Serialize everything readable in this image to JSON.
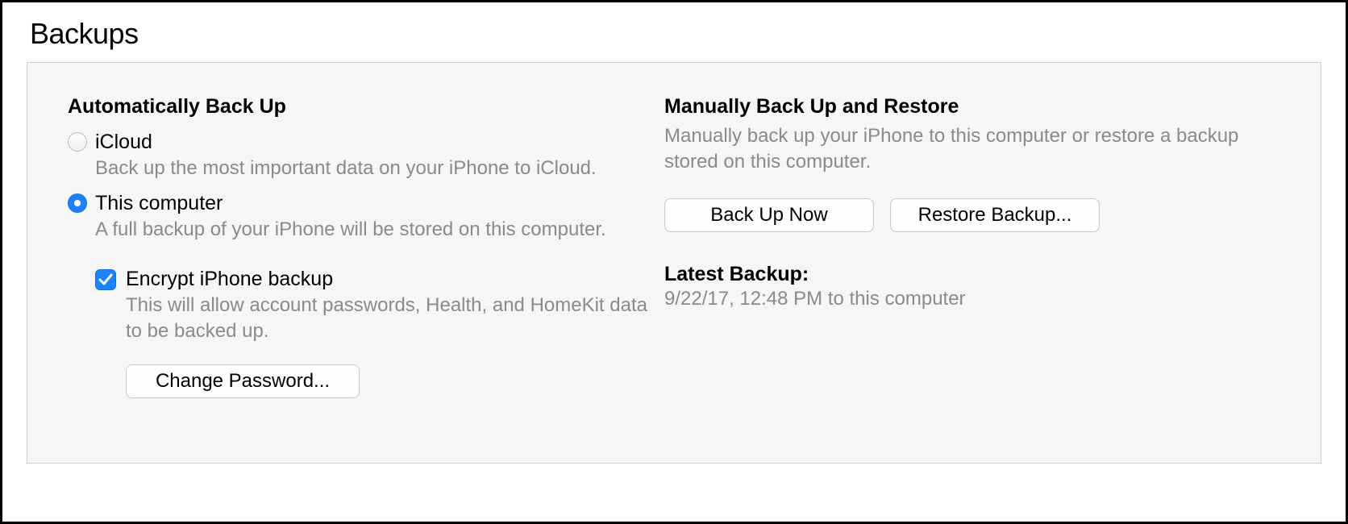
{
  "section_title": "Backups",
  "auto": {
    "heading": "Automatically Back Up",
    "icloud": {
      "label": "iCloud",
      "desc": "Back up the most important data on your iPhone to iCloud.",
      "selected": false
    },
    "computer": {
      "label": "This computer",
      "desc": "A full backup of your iPhone will be stored on this computer.",
      "selected": true
    },
    "encrypt": {
      "label": "Encrypt iPhone backup",
      "desc": "This will allow account passwords, Health, and HomeKit data to be backed up.",
      "checked": true
    },
    "change_password_label": "Change Password..."
  },
  "manual": {
    "heading": "Manually Back Up and Restore",
    "desc": "Manually back up your iPhone to this computer or restore a backup stored on this computer.",
    "backup_now_label": "Back Up Now",
    "restore_label": "Restore Backup..."
  },
  "latest": {
    "heading": "Latest Backup:",
    "value": "9/22/17, 12:48 PM to this computer"
  }
}
